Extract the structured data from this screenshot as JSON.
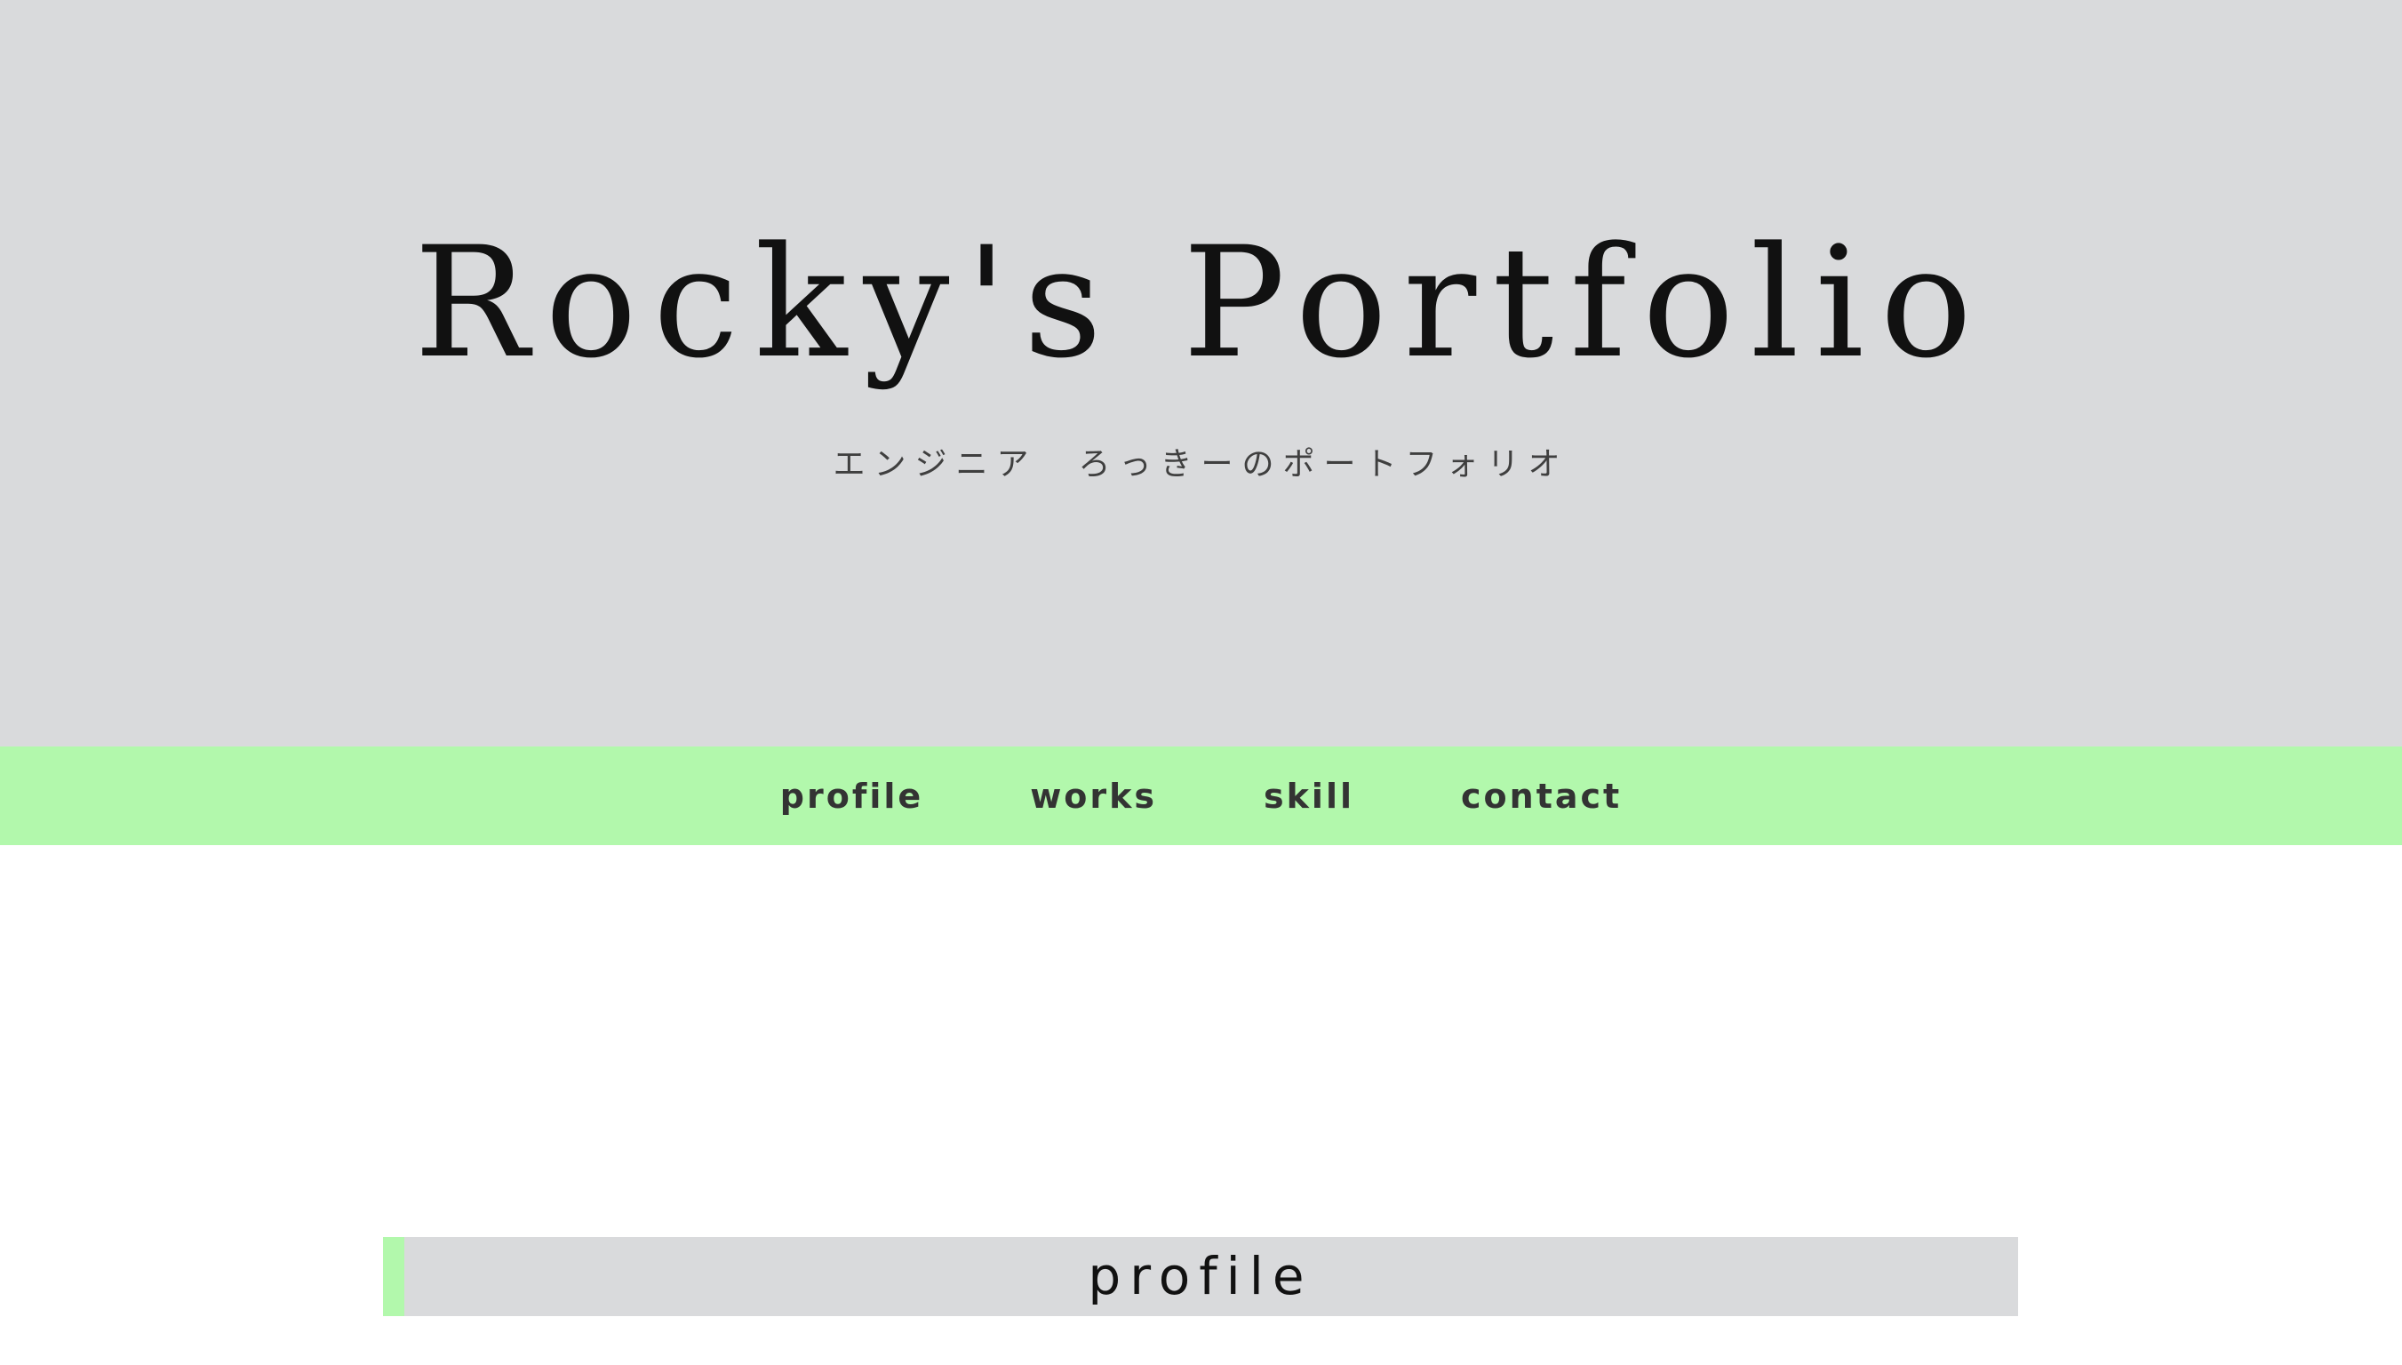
{
  "hero": {
    "title": "Rocky's Portfolio",
    "subtitle": "エンジニア　ろっきーのポートフォリオ"
  },
  "nav": {
    "items": [
      {
        "label": "profile"
      },
      {
        "label": "works"
      },
      {
        "label": "skill"
      },
      {
        "label": "contact"
      }
    ]
  },
  "sections": {
    "profile": {
      "heading": "profile"
    }
  },
  "colors": {
    "hero_background": "#d9dadc",
    "accent_green": "#b2f8ac",
    "page_background": "#ffffff"
  }
}
